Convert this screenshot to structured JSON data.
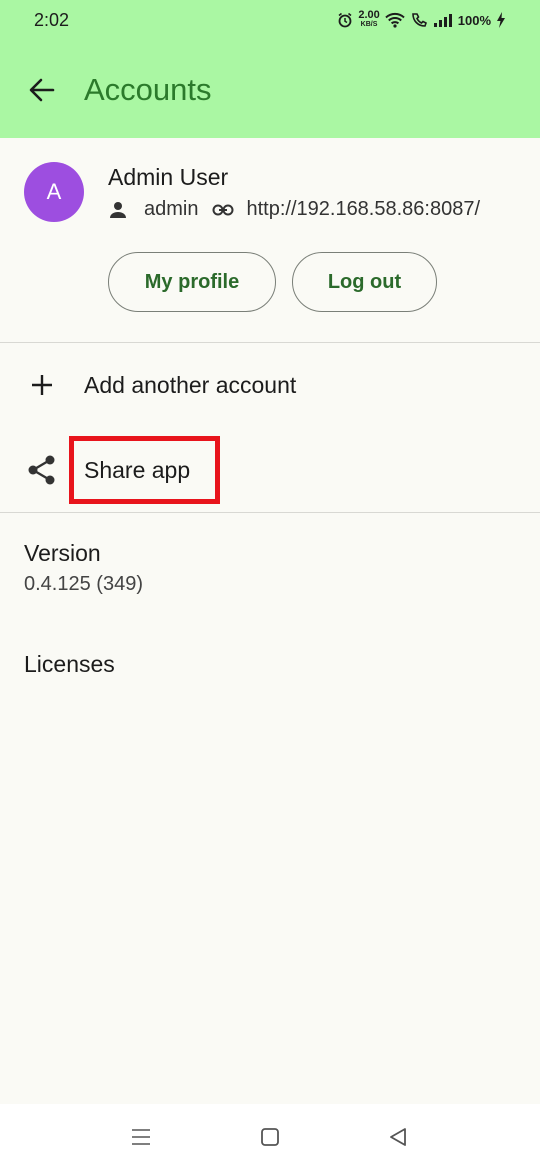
{
  "status_bar": {
    "time": "2:02",
    "net_speed": "2.00",
    "net_unit": "KB/S",
    "battery": "100%"
  },
  "app_bar": {
    "title": "Accounts",
    "back_icon": "arrow-back-icon"
  },
  "account": {
    "avatar_letter": "A",
    "avatar_color": "#9d4ee0",
    "name": "Admin User",
    "username": "admin",
    "server_url": "http://192.168.58.86:8087/",
    "buttons": {
      "profile": "My profile",
      "logout": "Log out"
    }
  },
  "menu": {
    "add_account": "Add another account",
    "share_app": "Share app"
  },
  "info": {
    "version_title": "Version",
    "version_value": "0.4.125 (349)",
    "licenses": "Licenses"
  },
  "colors": {
    "header_bg": "#aaf7a3",
    "accent_text": "#2b7a2b",
    "highlight": "#e8141c"
  }
}
